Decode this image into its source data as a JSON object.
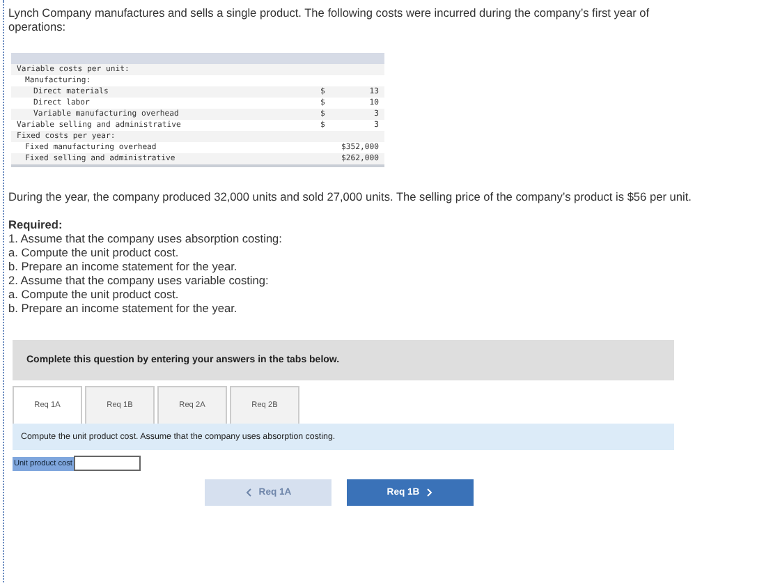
{
  "intro": "Lynch Company manufactures and sells a single product. The following costs were incurred during the company’s first year of operations:",
  "cost_table": {
    "rows": [
      {
        "label": "Variable costs per unit:",
        "children": [
          {
            "label": "Manufacturing:",
            "children": [
              {
                "label": "Direct materials",
                "currency": "$",
                "amount": "13"
              },
              {
                "label": "Direct labor",
                "currency": "$",
                "amount": "10"
              },
              {
                "label": "Variable manufacturing overhead",
                "currency": "$",
                "amount": "3"
              }
            ]
          }
        ]
      },
      {
        "label": "Variable selling and administrative",
        "currency": "$",
        "amount": "3"
      },
      {
        "label": "Fixed costs per year:",
        "children": [
          {
            "label": "Fixed manufacturing overhead",
            "amount": "$352,000"
          },
          {
            "label": "Fixed selling and administrative",
            "amount": "$262,000"
          }
        ]
      }
    ]
  },
  "facts": "During the year, the company produced 32,000 units and sold 27,000 units. The selling price of the company’s product is $56 per unit.",
  "required_title": "Required:",
  "required_lines": [
    "1. Assume that the company uses absorption costing:",
    "a. Compute the unit product cost.",
    "b. Prepare an income statement for the year.",
    "2. Assume that the company uses variable costing:",
    "a. Compute the unit product cost.",
    "b. Prepare an income statement for the year."
  ],
  "instruction_banner": "Complete this question by entering your answers in the tabs below.",
  "tabs": [
    {
      "label": "Req 1A",
      "selected": true
    },
    {
      "label": "Req 1B",
      "selected": false
    },
    {
      "label": "Req 2A",
      "selected": false
    },
    {
      "label": "Req 2B",
      "selected": false
    }
  ],
  "tab_prompt": "Compute the unit product cost. Assume that the company uses absorption costing.",
  "answer": {
    "label": "Unit product cost"
  },
  "nav": [
    {
      "label": "Req 1A",
      "kind": "prev",
      "disabled": true
    },
    {
      "label": "Req 1B",
      "kind": "next",
      "disabled": false
    }
  ]
}
